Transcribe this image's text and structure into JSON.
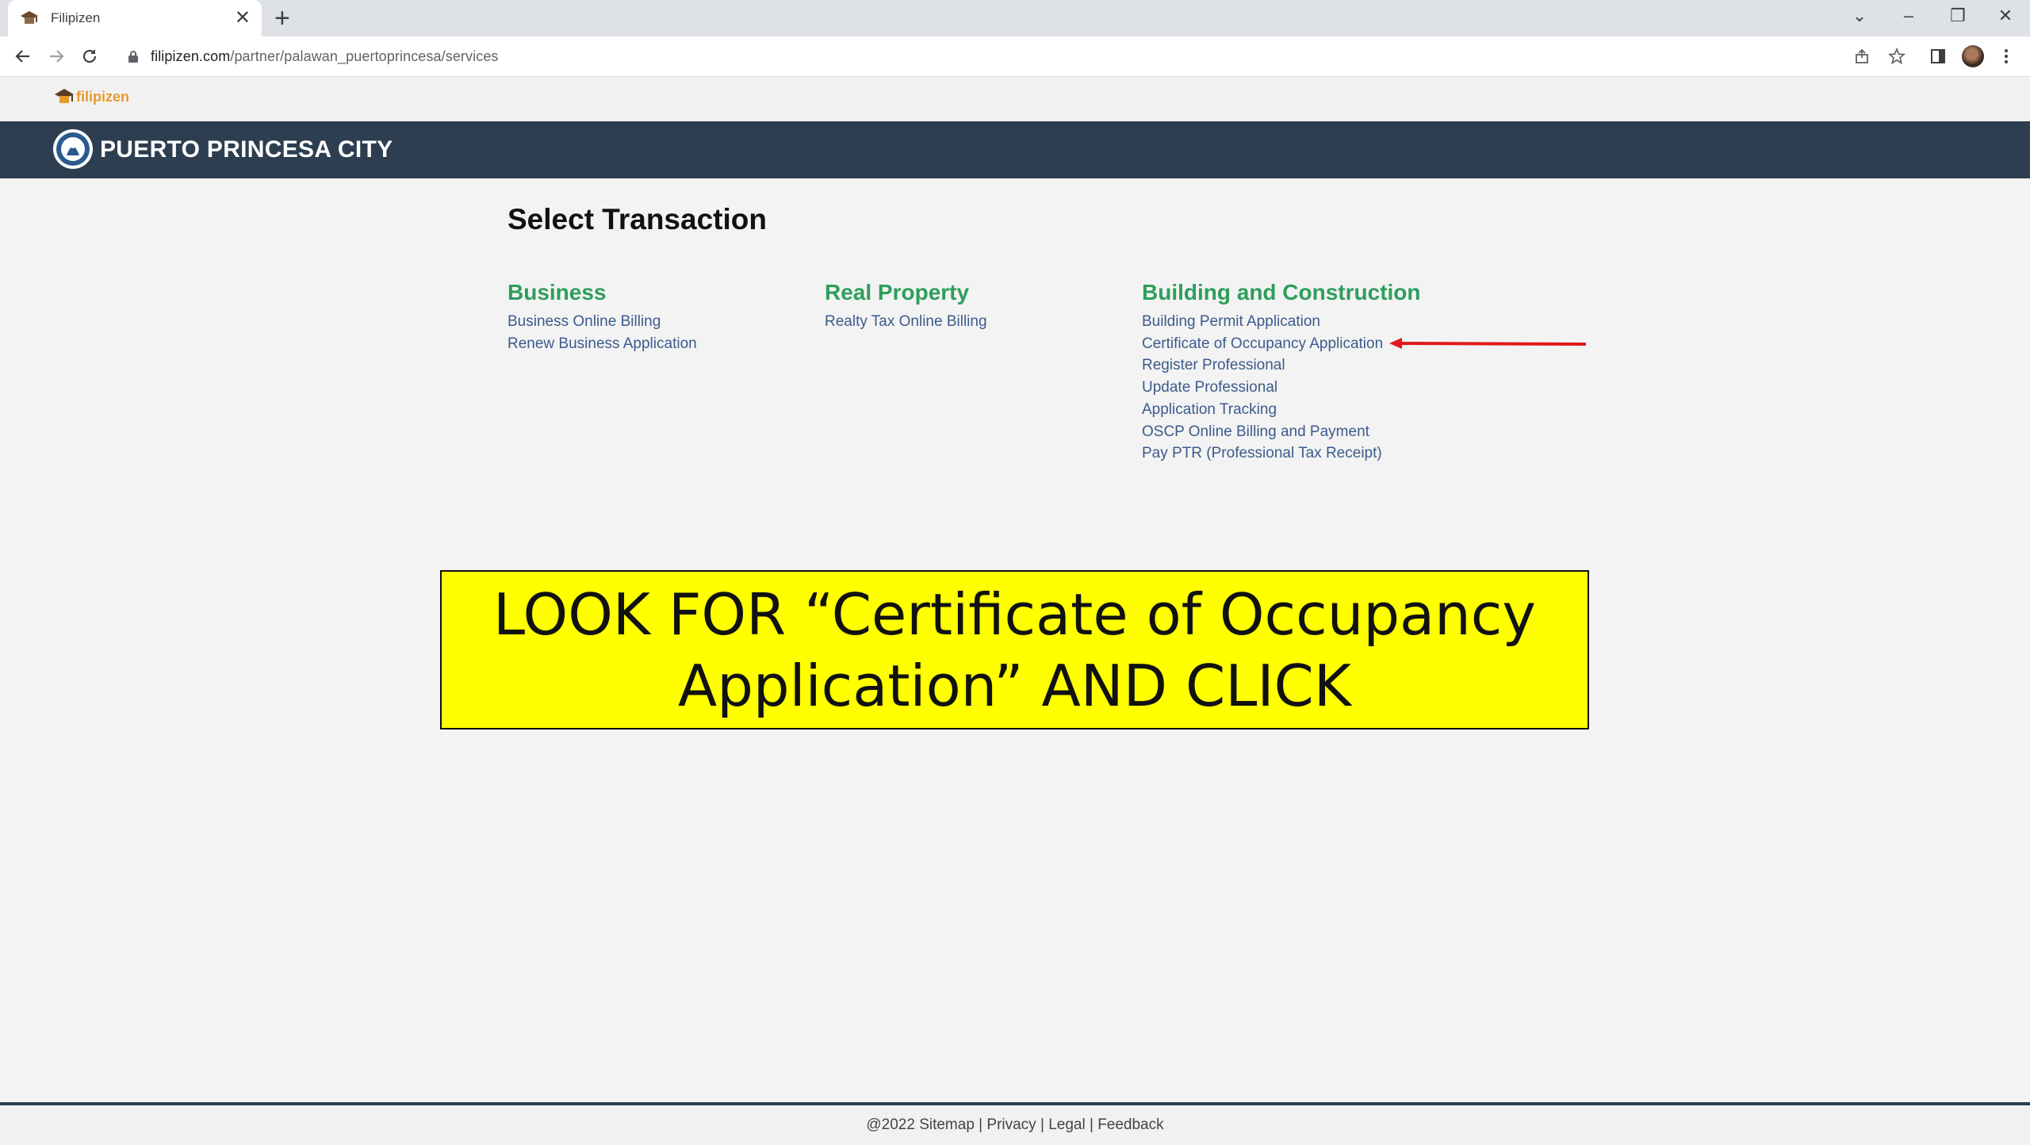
{
  "browser": {
    "tab_title": "Filipizen",
    "tab_close": "✕",
    "new_tab": "+",
    "url_host": "filipizen.com",
    "url_path": "/partner/palawan_puertoprincesa/services",
    "window_controls": [
      "⌄",
      "–",
      "❐",
      "✕"
    ]
  },
  "site": {
    "brand": "filipizen",
    "city_name": "PUERTO PRINCESA CITY"
  },
  "main": {
    "heading": "Select Transaction",
    "categories": [
      {
        "title": "Business",
        "links": [
          "Business Online Billing",
          "Renew Business Application"
        ]
      },
      {
        "title": "Real Property",
        "links": [
          "Realty Tax Online Billing"
        ]
      },
      {
        "title": "Building and Construction",
        "links": [
          "Building Permit Application",
          "Certificate of Occupancy Application",
          "Register Professional",
          "Update Professional",
          "Application Tracking",
          "OSCP Online Billing and Payment",
          "Pay PTR (Professional Tax Receipt)"
        ]
      }
    ]
  },
  "annotation": {
    "line1": "LOOK FOR “Certificate of Occupancy",
    "line2": "Application” AND CLICK",
    "arrow_color": "#e0191b",
    "box_color": "#ffff00"
  },
  "footer": {
    "copyright": "@2022",
    "links": [
      "Sitemap",
      "Privacy",
      "Legal",
      "Feedback"
    ],
    "separator": "|"
  }
}
